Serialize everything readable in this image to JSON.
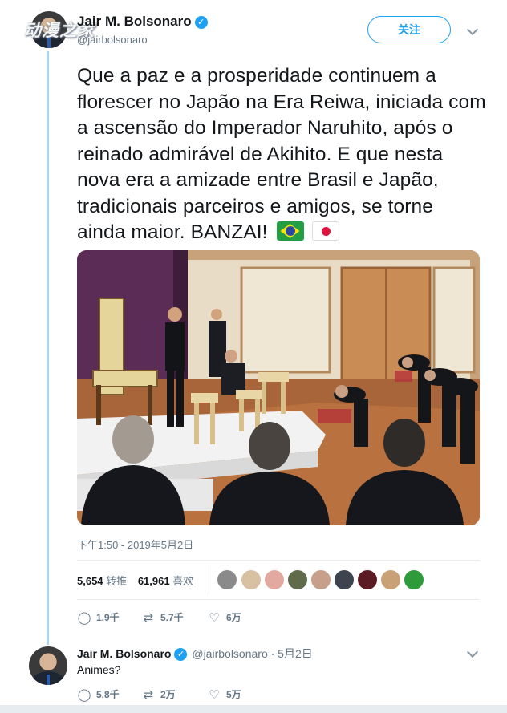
{
  "watermark": "动漫之家",
  "tweet": {
    "author_name": "Jair M. Bolsonaro",
    "author_handle": "@jairbolsonaro",
    "follow_label": "关注",
    "text": "Que a paz e a prosperidade continuem a florescer no Japão na Era Reiwa, iniciada com a ascensão do Imperador Naruhito, após o reinado admirável de Akihito. E que nesta nova era a amizade entre Brasil e Japão, tradicionais parceiros e amigos, se torne ainda maior. BANZAI!",
    "emoji": [
      "brazil-flag",
      "japan-flag"
    ],
    "image_icon": "ceremony-photo",
    "timestamp": "下午1:50 - 2019年5月2日",
    "retweets_count": "5,654",
    "retweets_label": "转推",
    "likes_count": "61,961",
    "likes_label": "喜欢",
    "liker_avatar_count": 9,
    "replies": "1.9千",
    "retweets": "5.7千",
    "likes": "6万"
  },
  "reply": {
    "author_name": "Jair M. Bolsonaro",
    "author_handle": "@jairbolsonaro · 5月2日",
    "text": "Animes?",
    "replies": "5.8千",
    "retweets": "2万",
    "likes": "5万"
  },
  "colors": {
    "accent": "#1da1f2",
    "thread_line": "#a9d6ee",
    "muted": "#657786"
  }
}
